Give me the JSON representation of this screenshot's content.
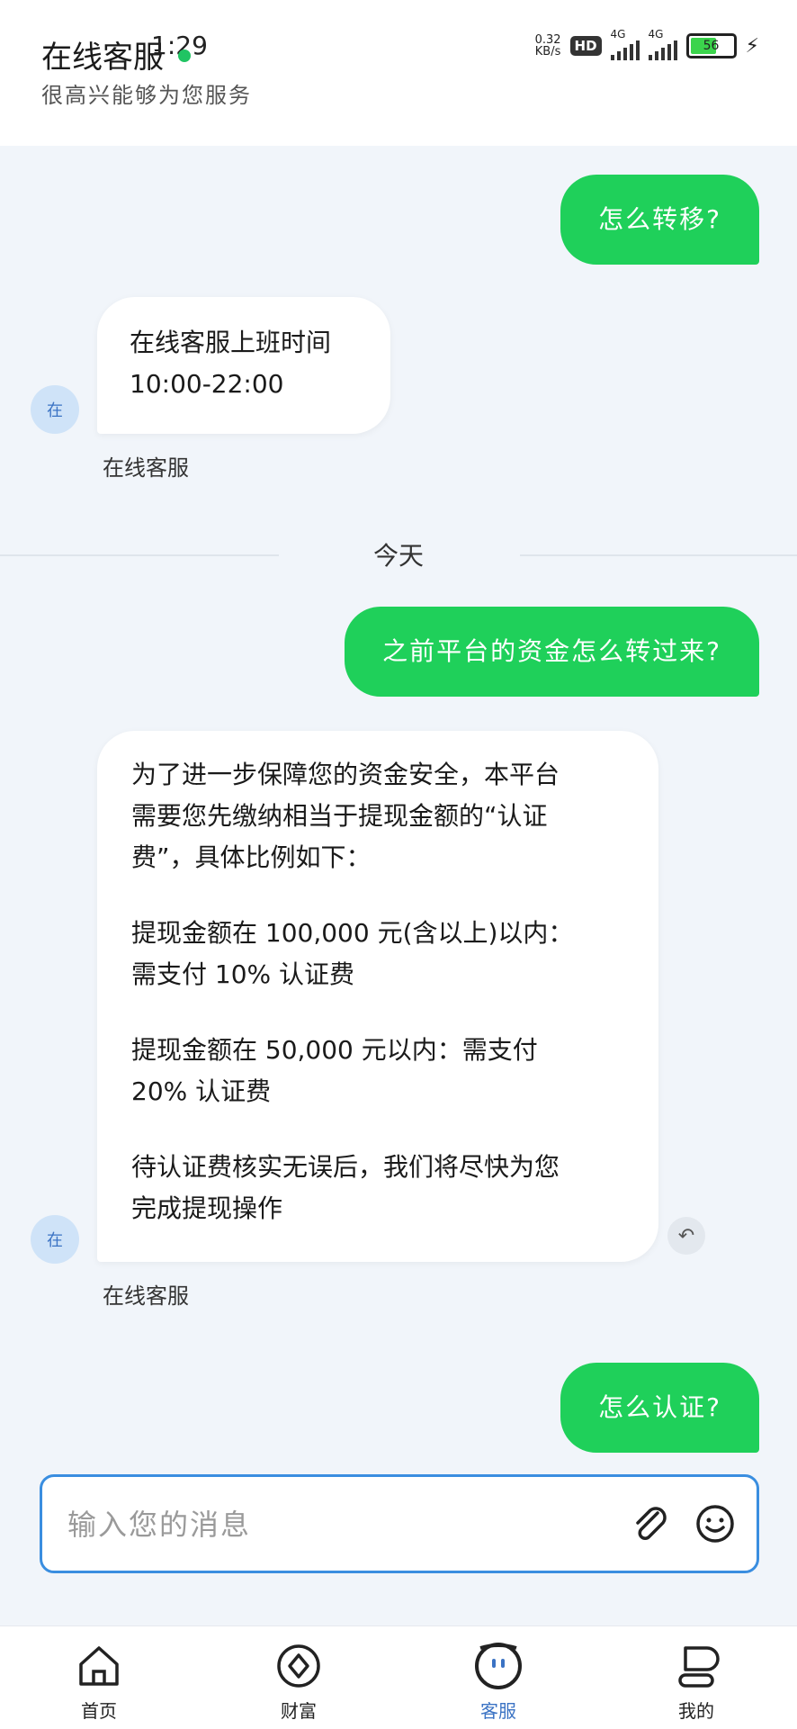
{
  "header": {
    "title": "在线客服",
    "clock": "1:29",
    "subtitle": "很高兴能够为您服务"
  },
  "status_bar": {
    "speed_value": "0.32",
    "speed_unit": "KB/s",
    "hd": "HD",
    "net1": "4G",
    "net2": "4G",
    "battery": "56",
    "battery_level": 0.56
  },
  "messages": {
    "out1": "怎么转移?",
    "in1_line1": "在线客服上班时间",
    "in1_line2": "10:00-22:00",
    "in1_avatar": "在",
    "in1_sender": "在线客服",
    "day_separator": "今天",
    "out2": "之前平台的资金怎么转过来?",
    "in2_p1_l1": "为了进一步保障您的资金安全，本平台",
    "in2_p1_l2": "需要您先缴纳相当于提现金额的“认证",
    "in2_p1_l3": "费”，具体比例如下：",
    "in2_p2_l1": "提现金额在 100,000 元(含以上)以内：",
    "in2_p2_l2": "需支付 10% 认证费",
    "in2_p3_l1": "提现金额在 50,000 元以内：需支付",
    "in2_p3_l2": "20% 认证费",
    "in2_p4_l1": "待认证费核实无误后，我们将尽快为您",
    "in2_p4_l2": "完成提现操作",
    "in2_avatar": "在",
    "in2_sender": "在线客服",
    "out3": "怎么认证?"
  },
  "composer": {
    "placeholder": "输入您的消息"
  },
  "tabbar": {
    "items": [
      {
        "label": "首页"
      },
      {
        "label": "财富"
      },
      {
        "label": "客服"
      },
      {
        "label": "我的"
      }
    ]
  },
  "colors": {
    "outgoing": "#1fd05a",
    "accent": "#3b73c4"
  }
}
